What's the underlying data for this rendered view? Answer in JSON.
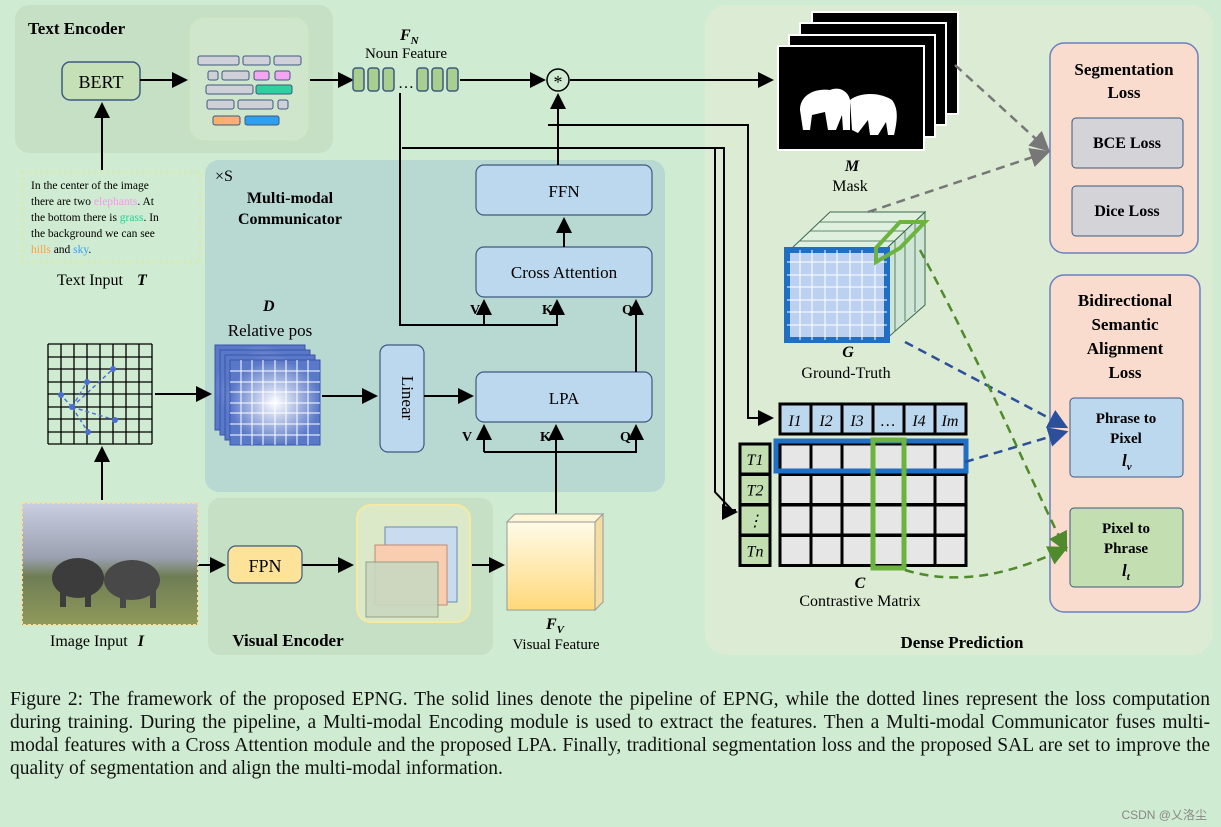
{
  "text_encoder": {
    "title": "Text Encoder",
    "bert": "BERT"
  },
  "text_input": {
    "lines": [
      "In the center of the image",
      "there are two ",
      "elephants",
      ". At",
      "the bottom there is ",
      "grass",
      ". In",
      "the background we can see",
      "hills",
      " and ",
      "sky",
      "."
    ],
    "label": "Text Input",
    "symbol": "T"
  },
  "noun_feature": {
    "symbol": "F",
    "sub": "N",
    "label": "Noun Feature",
    "ellipsis": "…"
  },
  "communicator": {
    "repeat": "×S",
    "title_1": "Multi-modal",
    "title_2": "Communicator",
    "ffn": "FFN",
    "cross_attention": "Cross Attention",
    "lpa": "LPA",
    "linear": "Linear",
    "v": "V",
    "k": "K",
    "q": "Q",
    "multiply": "*"
  },
  "relative_pos": {
    "symbol": "D",
    "label": "Relative pos"
  },
  "image_input": {
    "label": "Image Input",
    "symbol": "I"
  },
  "visual_encoder": {
    "title": "Visual Encoder",
    "fpn": "FPN"
  },
  "visual_feature": {
    "symbol": "F",
    "sub": "V",
    "label": "Visual Feature"
  },
  "dense": {
    "title": "Dense Prediction",
    "mask_symbol": "M",
    "mask_label": "Mask",
    "gt_symbol": "G",
    "gt_label": "Ground-Truth",
    "matrix_symbol": "C",
    "matrix_label": "Contrastive Matrix"
  },
  "matrix": {
    "cols": [
      "I1",
      "I2",
      "I3",
      "…",
      "I4",
      "Im"
    ],
    "rows": [
      "T1",
      "T2",
      "⋮",
      "Tn"
    ]
  },
  "seg_loss": {
    "title_1": "Segmentation",
    "title_2": "Loss",
    "bce": "BCE Loss",
    "dice": "Dice Loss"
  },
  "sal": {
    "title": [
      "Bidirectional",
      "Semantic",
      "Alignment",
      "Loss"
    ],
    "p2p_1": "Phrase to",
    "p2p_2": "Pixel",
    "p2p_sym": "l",
    "p2p_sub": "v",
    "pix_1": "Pixel to",
    "pix_2": "Phrase",
    "pix_sym": "l",
    "pix_sub": "t"
  },
  "caption": "Figure 2: The framework of the proposed EPNG. The solid lines denote the pipeline of EPNG, while the dotted lines represent the loss computation during training. During the pipeline, a Multi-modal Encoding module is used to extract the features. Then a Multi-modal Communicator fuses multi-modal features with a Cross Attention module and the proposed LPA. Finally, traditional segmentation loss and the proposed SAL are set to improve the quality of segmentation and align the multi-modal information.",
  "watermark": "CSDN @乂洛尘",
  "colors": {
    "background": "#cfebd1",
    "text_panel": "#c6e0c6",
    "communicator": "#b8d8d2",
    "dense": "#dcebd4",
    "seg_loss": "#f9dccd",
    "blue_box": "#bcd8ee",
    "green_box": "#c3dfb2",
    "highlight_blue": "#1f6fc4",
    "highlight_green": "#6db33f"
  }
}
